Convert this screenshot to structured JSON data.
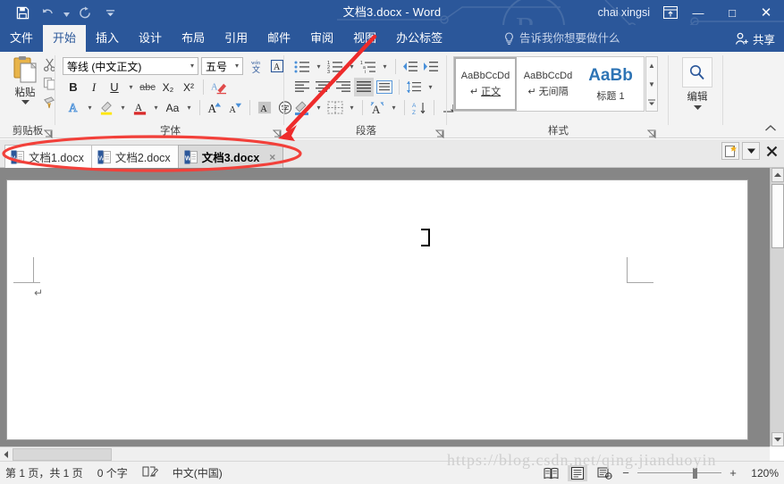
{
  "window": {
    "title": "文档3.docx  -  Word",
    "user": "chai xingsi",
    "quick_access": [
      {
        "name": "save",
        "icon": "save-icon"
      },
      {
        "name": "undo",
        "icon": "undo-icon"
      },
      {
        "name": "redo",
        "icon": "redo-icon"
      },
      {
        "name": "customize",
        "icon": "caret-down-icon"
      }
    ],
    "ribbon_display_icon": "ribbon-display-options-icon",
    "minimize": "—",
    "maximize": "□",
    "close": "✕"
  },
  "ribbon_tabs": {
    "items": [
      {
        "label": "文件",
        "active": false
      },
      {
        "label": "开始",
        "active": true
      },
      {
        "label": "插入",
        "active": false
      },
      {
        "label": "设计",
        "active": false
      },
      {
        "label": "布局",
        "active": false
      },
      {
        "label": "引用",
        "active": false
      },
      {
        "label": "邮件",
        "active": false
      },
      {
        "label": "审阅",
        "active": false
      },
      {
        "label": "视图",
        "active": false
      },
      {
        "label": "办公标签",
        "active": false
      }
    ],
    "tell_me": "告诉我你想要做什么",
    "share": "共享"
  },
  "ribbon": {
    "groups": {
      "clipboard": {
        "label": "剪贴板",
        "paste_label": "粘贴",
        "buttons": [
          "cut-icon",
          "copy-icon",
          "format-painter-icon"
        ]
      },
      "font": {
        "label": "字体",
        "font_name": "等线 (中文正文)",
        "font_size": "五号",
        "bold": "B",
        "italic": "I",
        "underline": "U",
        "strikethrough": "abc",
        "subscript": "X₂",
        "superscript": "X²",
        "change_case": "Aa",
        "grow_font": "A",
        "shrink_font": "A",
        "text_highlight": "phonetic-guide-icon",
        "clear_formatting": "clear-format-icon"
      },
      "paragraph": {
        "label": "段落"
      },
      "styles": {
        "label": "样式",
        "items": [
          {
            "preview": "AaBbCcDd",
            "name": "正文",
            "selected": true
          },
          {
            "preview": "AaBbCcDd",
            "name": "无间隔",
            "selected": false
          },
          {
            "preview": "AaBb",
            "name": "标题 1",
            "selected": false
          }
        ]
      },
      "editing": {
        "label": "编辑",
        "icon": "find-icon"
      }
    }
  },
  "doc_tabs": {
    "items": [
      {
        "label": "文档1.docx",
        "active": false
      },
      {
        "label": "文档2.docx",
        "active": false
      },
      {
        "label": "文档3.docx",
        "active": true
      }
    ],
    "close_glyph": "×",
    "buttons": [
      {
        "name": "new-document-button",
        "icon": "new-doc-icon"
      },
      {
        "name": "tab-menu-button",
        "icon": "caret-down-icon"
      },
      {
        "name": "close-tab-button",
        "icon": "close-icon"
      }
    ]
  },
  "document": {
    "paragraph_mark": "↵"
  },
  "status_bar": {
    "page_info": "第 1 页，共 1 页",
    "word_count": "0 个字",
    "proofing_icon": "proofing-icon",
    "language": "中文(中国)",
    "views": [
      {
        "name": "read-mode",
        "icon": "read-mode-icon",
        "selected": false
      },
      {
        "name": "print-layout",
        "icon": "print-layout-icon",
        "selected": true
      },
      {
        "name": "web-layout",
        "icon": "web-layout-icon",
        "selected": false
      }
    ],
    "zoom_out": "−",
    "zoom_in": "+",
    "zoom_level": "120%"
  },
  "watermark": "https://blog.csdn.net/qing.jianduoyin",
  "colors": {
    "titlebar": "#2b579a",
    "ribbon_bg": "#f3f3f3",
    "doc_bg": "#868686",
    "annotation_red": "#ee2b2b",
    "accent_blue": "#2e74b5"
  }
}
